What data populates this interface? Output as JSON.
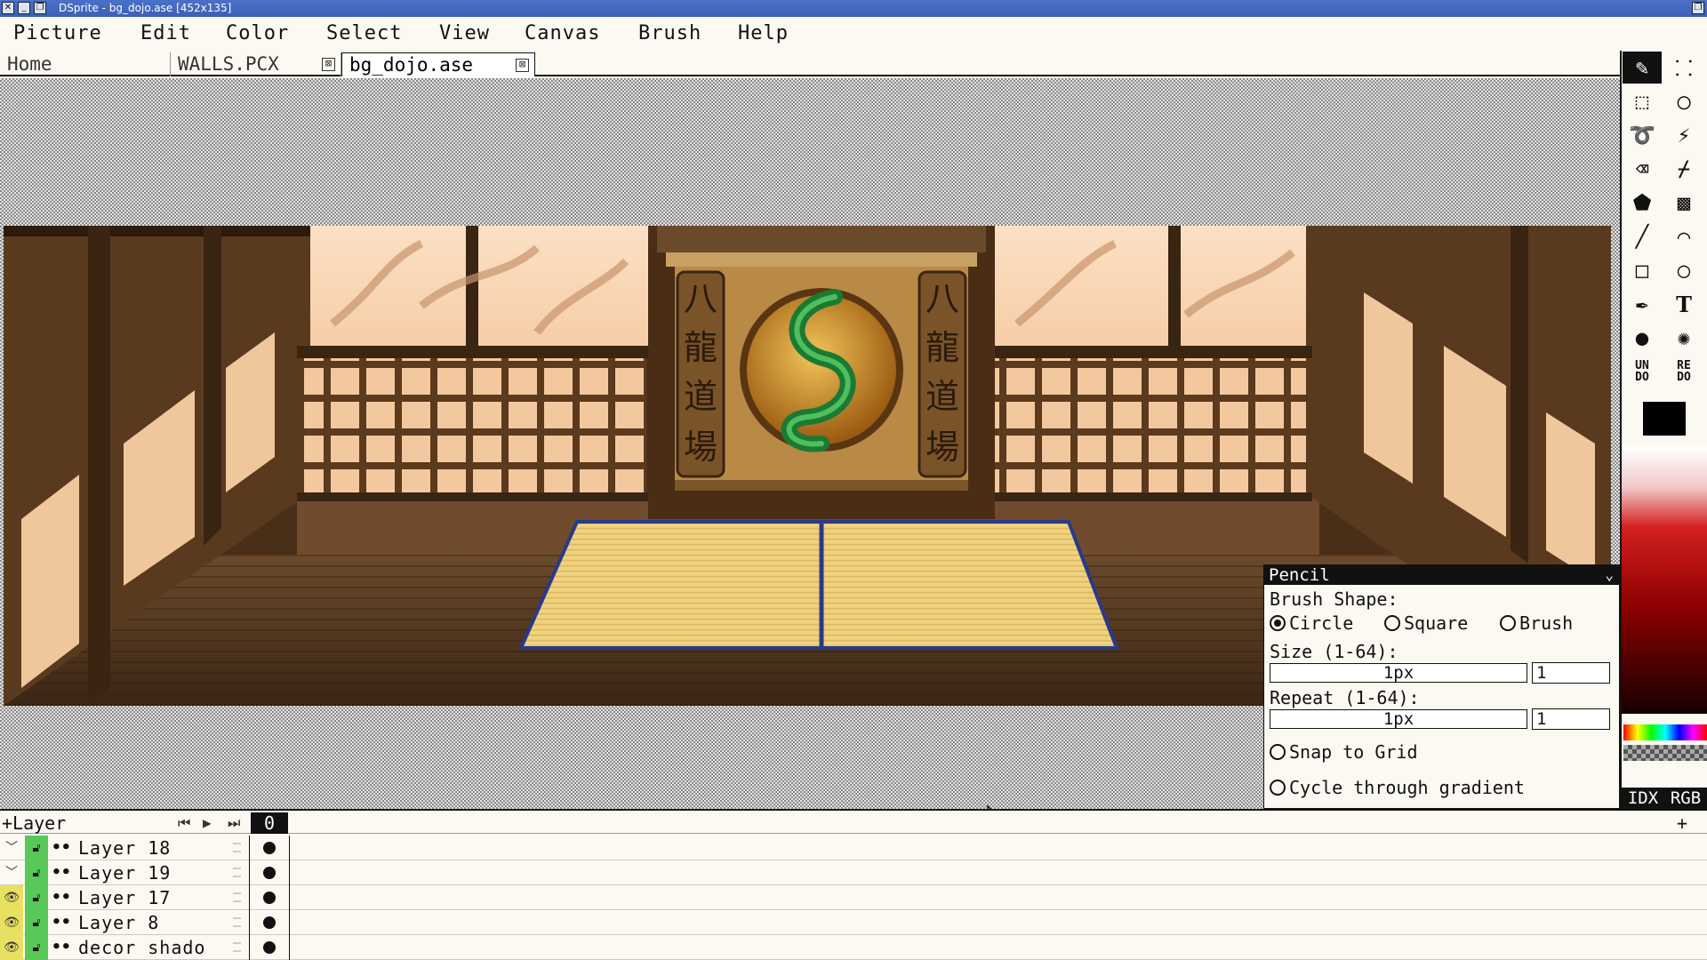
{
  "window": {
    "title": "DSprite - bg_dojo.ase [452x135]",
    "controls": [
      "✕",
      "_",
      "❐"
    ]
  },
  "menu": [
    "Picture",
    "Edit",
    "Color",
    "Select",
    "View",
    "Canvas",
    "Brush",
    "Help"
  ],
  "tabs": [
    {
      "label": "Home",
      "active": false
    },
    {
      "label": "WALLS.PCX",
      "active": false,
      "close": "⊠"
    },
    {
      "label": "bg_dojo.ase",
      "active": true,
      "close": "⊠"
    }
  ],
  "tools": {
    "rows": [
      [
        "pencil-icon",
        "spray-icon"
      ],
      [
        "rect-select-icon",
        "ellipse-select-icon"
      ],
      [
        "lasso-icon",
        "magic-wand-icon"
      ],
      [
        "eraser-icon",
        "eyedropper-icon"
      ],
      [
        "fill-icon",
        "dither-icon"
      ],
      [
        "line-icon",
        "curve-icon"
      ],
      [
        "rectangle-icon",
        "circle-icon"
      ],
      [
        "smudge-icon",
        "text-icon"
      ],
      [
        "blur-icon",
        "sparkle-icon"
      ]
    ],
    "undo": "UN\nDO",
    "redo": "RE\nDO",
    "text_glyph": "T"
  },
  "colors": {
    "primary": "#000000",
    "accent": "#111111",
    "mode_idx": "IDX",
    "mode_rgb": "RGB"
  },
  "pencil": {
    "title": "Pencil",
    "brush_shape_label": "Brush Shape:",
    "shapes": [
      "Circle",
      "Square",
      "Brush"
    ],
    "size_label": "Size (1-64):",
    "size_slider": "1px",
    "size_value": "1",
    "repeat_label": "Repeat (1-64):",
    "repeat_slider": "1px",
    "repeat_value": "1",
    "snap_label": "Snap to Grid",
    "cycle_label": "Cycle through gradient"
  },
  "timeline": {
    "add_layer": "+Layer",
    "frame": "0",
    "add_frame": "+",
    "layers": [
      {
        "name": "Layer 18",
        "visible": false
      },
      {
        "name": "Layer 19",
        "visible": false
      },
      {
        "name": "Layer 17",
        "visible": true
      },
      {
        "name": "Layer 8",
        "visible": true
      },
      {
        "name": "decor shado",
        "visible": true
      }
    ]
  },
  "artwork": {
    "kanji_left": [
      "八",
      "龍",
      "道",
      "場"
    ],
    "kanji_right": [
      "八",
      "龍",
      "道",
      "場"
    ]
  }
}
